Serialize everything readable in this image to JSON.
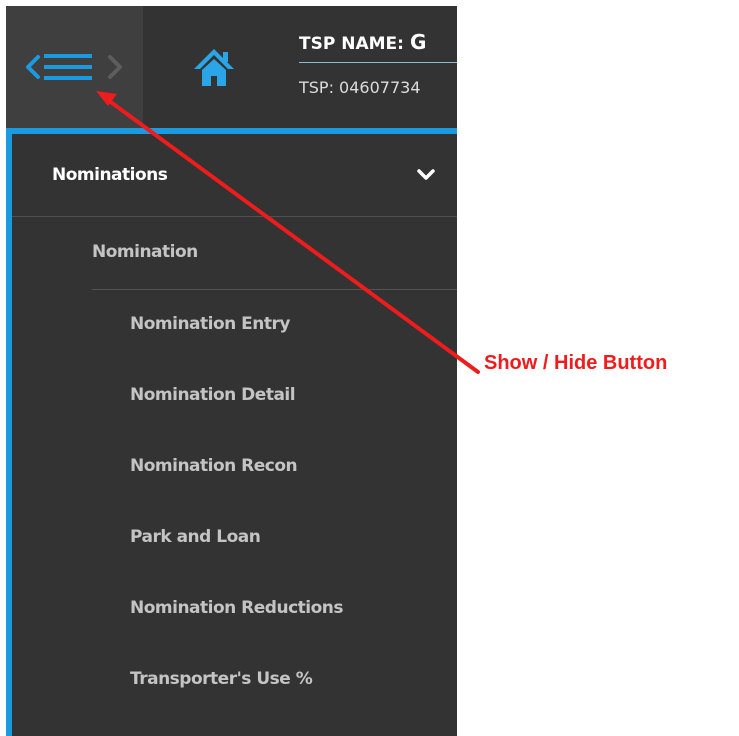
{
  "header": {
    "tsp_name_label": "TSP NAME:",
    "tsp_name_value": "G",
    "tsp_id": "TSP: 04607734"
  },
  "menu": {
    "section_label": "Nominations",
    "group_label": "Nomination",
    "items": [
      {
        "label": "Nomination Entry"
      },
      {
        "label": "Nomination Detail"
      },
      {
        "label": "Nomination Recon"
      },
      {
        "label": "Park and Loan"
      },
      {
        "label": "Nomination Reductions"
      },
      {
        "label": "Transporter's Use %"
      }
    ]
  },
  "annotation": {
    "label": "Show / Hide Button"
  },
  "colors": {
    "panel_bg": "#333333",
    "toggle_bg": "#3f3f3f",
    "accent_blue": "#1a9be0",
    "annotation_red": "#ee1c1c"
  },
  "icons": {
    "toggle": "hamburger-arrows-icon",
    "home": "home-icon",
    "chevron": "chevron-down-icon"
  }
}
